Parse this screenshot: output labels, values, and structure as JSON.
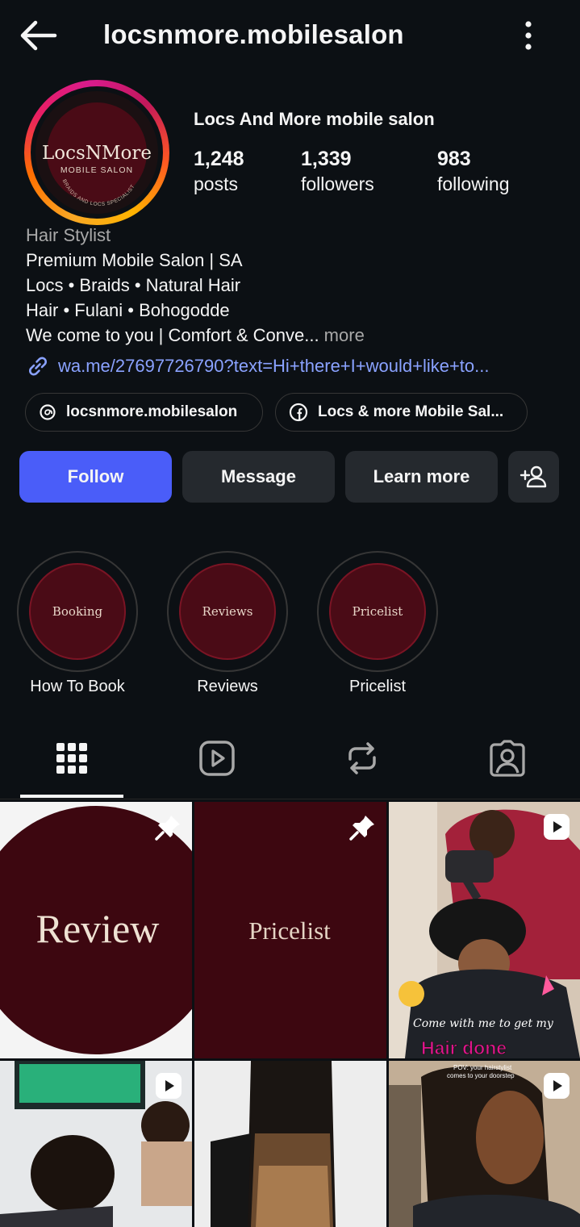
{
  "header": {
    "username": "locsnmore.mobilesalon"
  },
  "profile": {
    "avatar_logo": "LocsNMore",
    "avatar_subtitle": "MOBILE SALON",
    "avatar_arc": "BRAIDS AND LOCS SPECIALIST",
    "display_name": "Locs And More mobile salon",
    "stats": [
      {
        "value": "1,248",
        "label": "posts"
      },
      {
        "value": "1,339",
        "label": "followers"
      },
      {
        "value": "983",
        "label": "following"
      }
    ],
    "category": "Hair Stylist",
    "bio": [
      "Premium Mobile Salon | SA",
      "Locs • Braids • Natural Hair",
      "Hair • Fulani • Bohogodde",
      "We come to you | Comfort & Conve..."
    ],
    "more_label": " more",
    "link": "wa.me/27697726790?text=Hi+there+I+would+like+to..."
  },
  "chips": [
    {
      "icon": "threads-icon",
      "label": "locsnmore.mobilesalon"
    },
    {
      "icon": "facebook-icon",
      "label": "Locs & more Mobile Sal..."
    }
  ],
  "actions": {
    "follow": "Follow",
    "message": "Message",
    "learn_more": "Learn more"
  },
  "highlights": [
    {
      "cover": "Booking",
      "label": "How To Book"
    },
    {
      "cover": "Reviews",
      "label": "Reviews"
    },
    {
      "cover": "Pricelist",
      "label": "Pricelist"
    }
  ],
  "tabs": [
    "grid-icon",
    "reels-icon",
    "reposts-icon",
    "tagged-icon"
  ],
  "posts": [
    {
      "title": "Review",
      "badge": "pin-icon"
    },
    {
      "title": "Pricelist",
      "badge": "pin-icon"
    },
    {
      "caption1": "Come with me to get my",
      "caption2": "Hair done",
      "badge": "reel-icon"
    },
    {
      "badge": "reel-icon"
    },
    {
      "badge": "none"
    },
    {
      "caption1": "POV: your hairstylist",
      "caption2": "comes to your doorstep",
      "badge": "reel-icon"
    }
  ],
  "colors": {
    "accent": "#4a5df9",
    "background": "#0c1014",
    "link": "#8aa2ff",
    "maroon": "#4a0b16"
  }
}
